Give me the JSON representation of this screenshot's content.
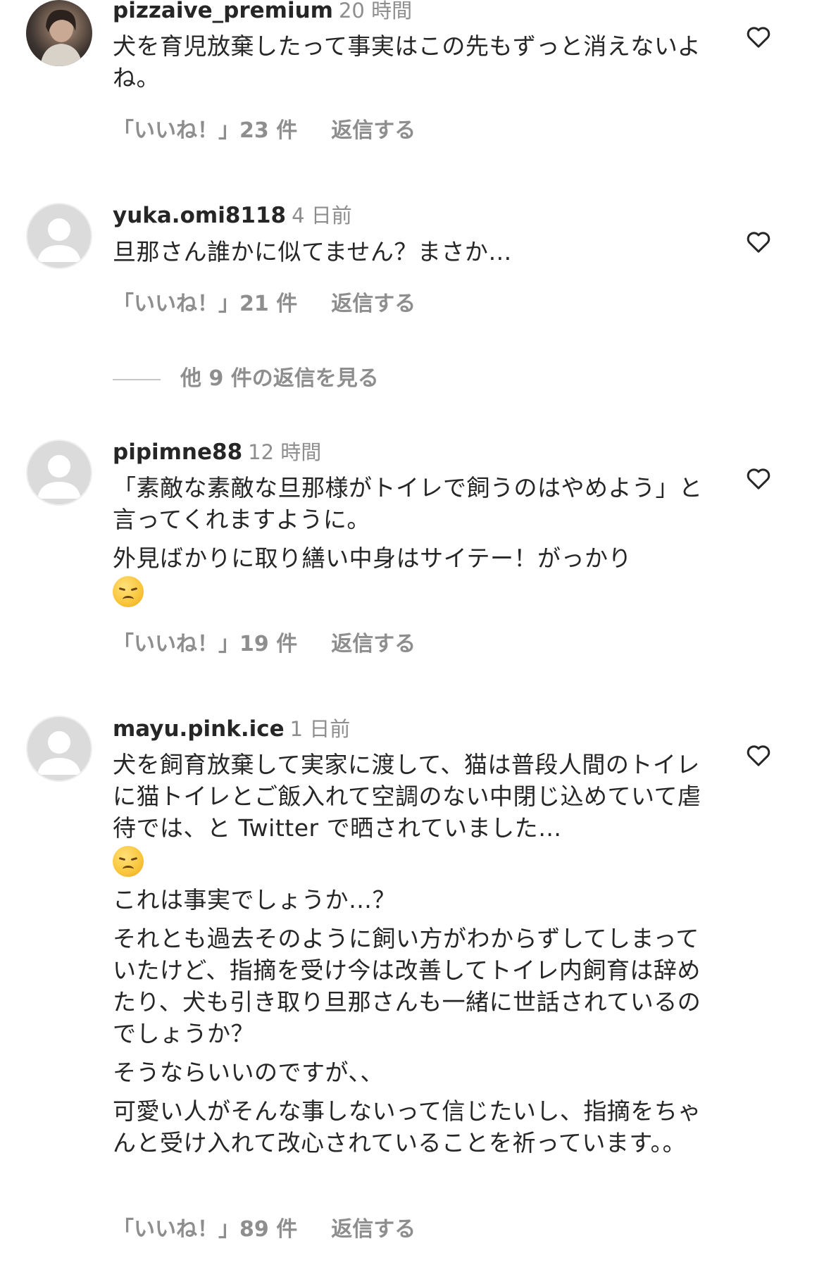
{
  "comments": [
    {
      "username": "pizzaive_premium",
      "time": "20 時間",
      "avatar": "photo",
      "paragraphs": [
        "犬を育児放棄したって事実はこの先もずっと消えないよね。"
      ],
      "likes": "「いいね！」23 件",
      "reply_label": "返信する"
    },
    {
      "username": "yuka.omi8118",
      "time": "4 日前",
      "avatar": "default",
      "paragraphs": [
        "旦那さん誰かに似てません？まさか…"
      ],
      "likes": "「いいね！」21 件",
      "reply_label": "返信する"
    },
    {
      "username": "pipimne88",
      "time": "12 時間",
      "avatar": "default",
      "paragraphs": [
        "「素敵な素敵な旦那様がトイレで飼うのはやめよう」と言ってくれますように。",
        "外見ばかりに取り繕い中身はサイテー！がっかり"
      ],
      "emoji": "disappointed-face",
      "likes": "「いいね！」19 件",
      "reply_label": "返信する"
    },
    {
      "username": "mayu.pink.ice",
      "time": "1 日前",
      "avatar": "default",
      "paragraphs": [
        "犬を飼育放棄して実家に渡して、猫は普段人間のトイレに猫トイレとご飯入れて空調のない中閉じ込めていて虐待では、と Twitter で晒されていました…",
        "これは事実でしょうか…？",
        "それとも過去そのように飼い方がわからずしてしまっていたけど、指摘を受け今は改善してトイレ内飼育は辞めたり、犬も引き取り旦那さんも一緒に世話されているのでしょうか？",
        "そうならいいのですが、、",
        "可愛い人がそんな事しないって信じたいし、指摘をちゃんと受け入れて改心されていることを祈っています。。"
      ],
      "emoji": "pensive-face",
      "likes": "「いいね！」89 件",
      "reply_label": "返信する"
    }
  ],
  "view_replies_label": "他 9 件の返信を見る",
  "icons": {
    "like": "heart-outline-icon",
    "avatar_default": "default-avatar-icon"
  },
  "colors": {
    "text": "#262626",
    "secondary": "#8e8e8e",
    "avatar_bg": "#dbdbdb"
  }
}
